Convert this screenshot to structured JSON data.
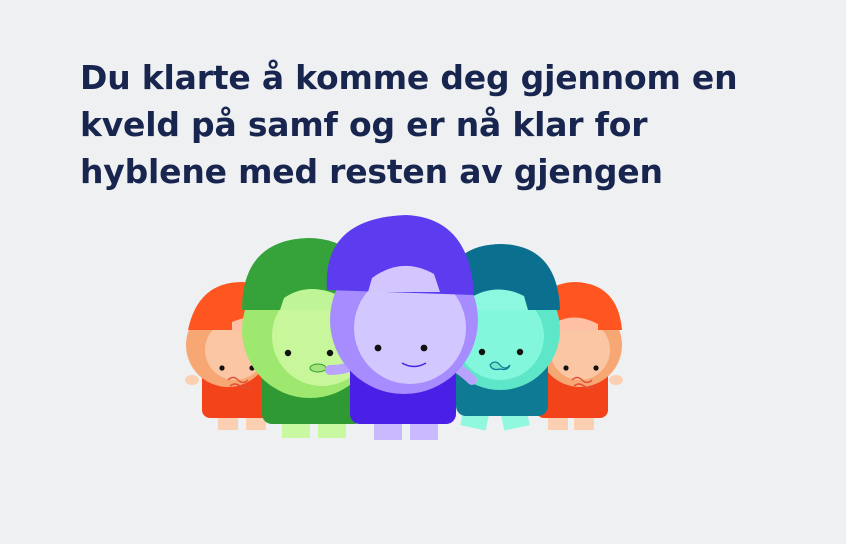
{
  "message": {
    "lines": [
      "Du klarte å komme deg gjennom en",
      "kveld på samf og er nå klar for",
      "hyblene med resten av gjengen"
    ]
  },
  "illustration": {
    "characters": [
      {
        "id": "orange-left",
        "cap_color": "#ff5520",
        "face_color": "#fbb890",
        "body_color": "#f2431b"
      },
      {
        "id": "green",
        "cap_color": "#36a33a",
        "face_color": "#c3f793",
        "body_color": "#2f9a34"
      },
      {
        "id": "purple-center",
        "cap_color": "#5d3cf0",
        "face_color": "#d2c6ff",
        "body_color": "#4b20e6"
      },
      {
        "id": "teal",
        "cap_color": "#0b7090",
        "face_color": "#7ff7d8",
        "body_color": "#0f7a93"
      },
      {
        "id": "orange-right",
        "cap_color": "#ff5520",
        "face_color": "#fbb890",
        "body_color": "#f2431b"
      }
    ]
  }
}
